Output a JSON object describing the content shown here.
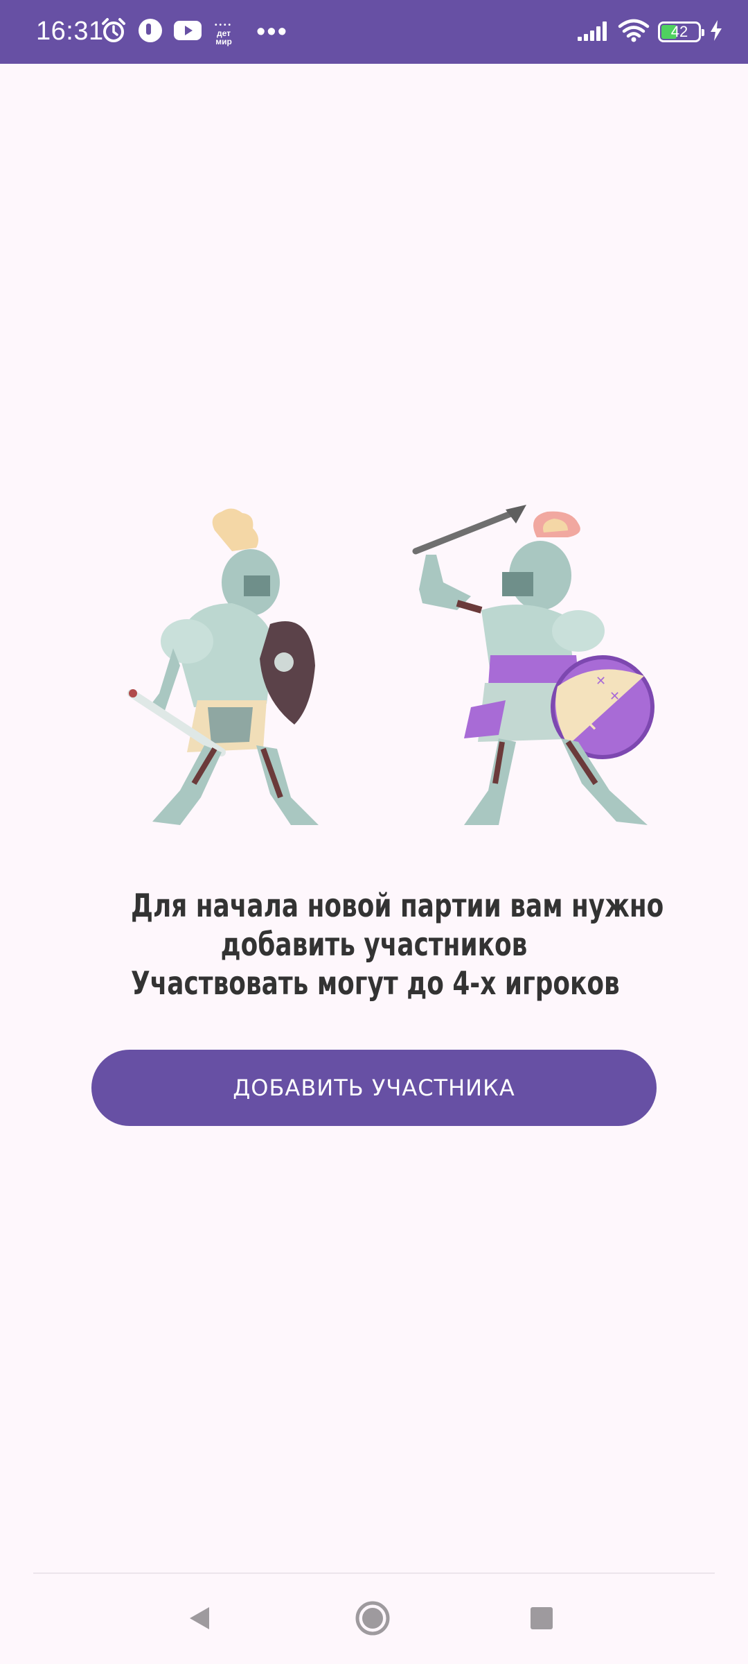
{
  "status_bar": {
    "time": "16:31",
    "battery_level": "42",
    "battery_fraction": 0.42,
    "app_badge_lines": [
      "дет",
      "мир"
    ],
    "more_indicator": "•••",
    "background_color": "#6750a4",
    "left_icons": [
      "alarm-icon",
      "notification-app-icon",
      "youtube-icon",
      "detmir-icon",
      "more-notifications-icon"
    ],
    "right_icons": [
      "signal-icon",
      "wifi-icon",
      "battery-icon",
      "charging-icon"
    ]
  },
  "illustration": {
    "name": "two-fighting-knights",
    "shield_accent_color": "#a86bd6"
  },
  "message": {
    "line1": "Для начала новой партии вам нужно",
    "line2": "добавить участников",
    "line3": "Участвовать могут до 4-х игроков"
  },
  "actions": {
    "add_participant_label": "ДОБАВИТЬ УЧАСТНИКА",
    "accent_color": "#6750a4"
  },
  "nav_bar": {
    "buttons": [
      "back-icon",
      "home-icon",
      "recents-icon"
    ]
  }
}
